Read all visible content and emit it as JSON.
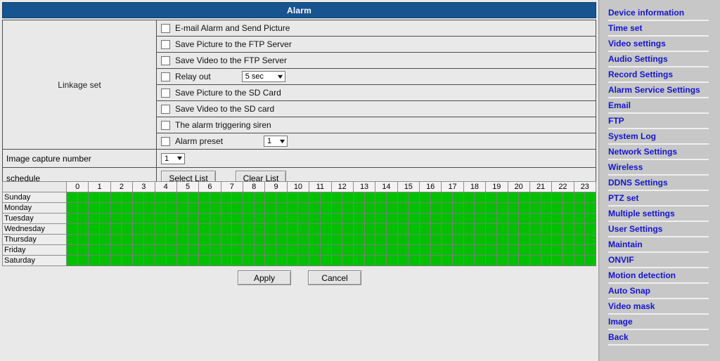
{
  "header": {
    "title": "Alarm"
  },
  "colors": {
    "title_bar": "#16558f",
    "schedule_selected": "#00c000",
    "sidebar_bg": "#c7c7c7",
    "sidebar_link": "#1414cf",
    "panel_bg": "#e9e9e9"
  },
  "form": {
    "linkage_label": "Linkage set",
    "options": [
      {
        "label": "E-mail Alarm and Send Picture",
        "checked": false
      },
      {
        "label": "Save Picture to the FTP Server",
        "checked": false
      },
      {
        "label": "Save Video to the FTP Server",
        "checked": false
      },
      {
        "label": "Relay out",
        "checked": false,
        "select_value": "5 sec"
      },
      {
        "label": "Save Picture to the SD Card",
        "checked": false
      },
      {
        "label": "Save Video to the SD card",
        "checked": false
      },
      {
        "label": "The alarm triggering siren",
        "checked": false
      },
      {
        "label": "Alarm preset",
        "checked": false,
        "select_value": "1"
      }
    ],
    "image_capture_number": {
      "label": "Image capture number",
      "value": "1"
    },
    "schedule": {
      "label": "schedule",
      "select_list_button": "Select List",
      "clear_list_button": "Clear List"
    }
  },
  "schedule_grid": {
    "hours": [
      "0",
      "1",
      "2",
      "3",
      "4",
      "5",
      "6",
      "7",
      "8",
      "9",
      "10",
      "11",
      "12",
      "13",
      "14",
      "15",
      "16",
      "17",
      "18",
      "19",
      "20",
      "21",
      "22",
      "23"
    ],
    "subcells_per_hour": 2,
    "days": [
      "Sunday",
      "Monday",
      "Tuesday",
      "Wednesday",
      "Thursday",
      "Friday",
      "Saturday"
    ],
    "all_selected": true
  },
  "footer": {
    "apply_button": "Apply",
    "cancel_button": "Cancel"
  },
  "sidebar": {
    "items": [
      {
        "label": "Device information"
      },
      {
        "label": "Time set"
      },
      {
        "label": "Video settings"
      },
      {
        "label": "Audio Settings"
      },
      {
        "label": "Record Settings"
      },
      {
        "label": "Alarm Service Settings"
      },
      {
        "label": "Email"
      },
      {
        "label": "FTP"
      },
      {
        "label": "System Log"
      },
      {
        "label": "Network Settings"
      },
      {
        "label": "Wireless"
      },
      {
        "label": "DDNS Settings"
      },
      {
        "label": "PTZ set"
      },
      {
        "label": "Multiple settings"
      },
      {
        "label": "User Settings"
      },
      {
        "label": "Maintain"
      },
      {
        "label": "ONVIF"
      },
      {
        "label": "Motion detection"
      },
      {
        "label": "Auto Snap"
      },
      {
        "label": "Video mask"
      },
      {
        "label": "Image"
      },
      {
        "label": "Back"
      }
    ]
  }
}
